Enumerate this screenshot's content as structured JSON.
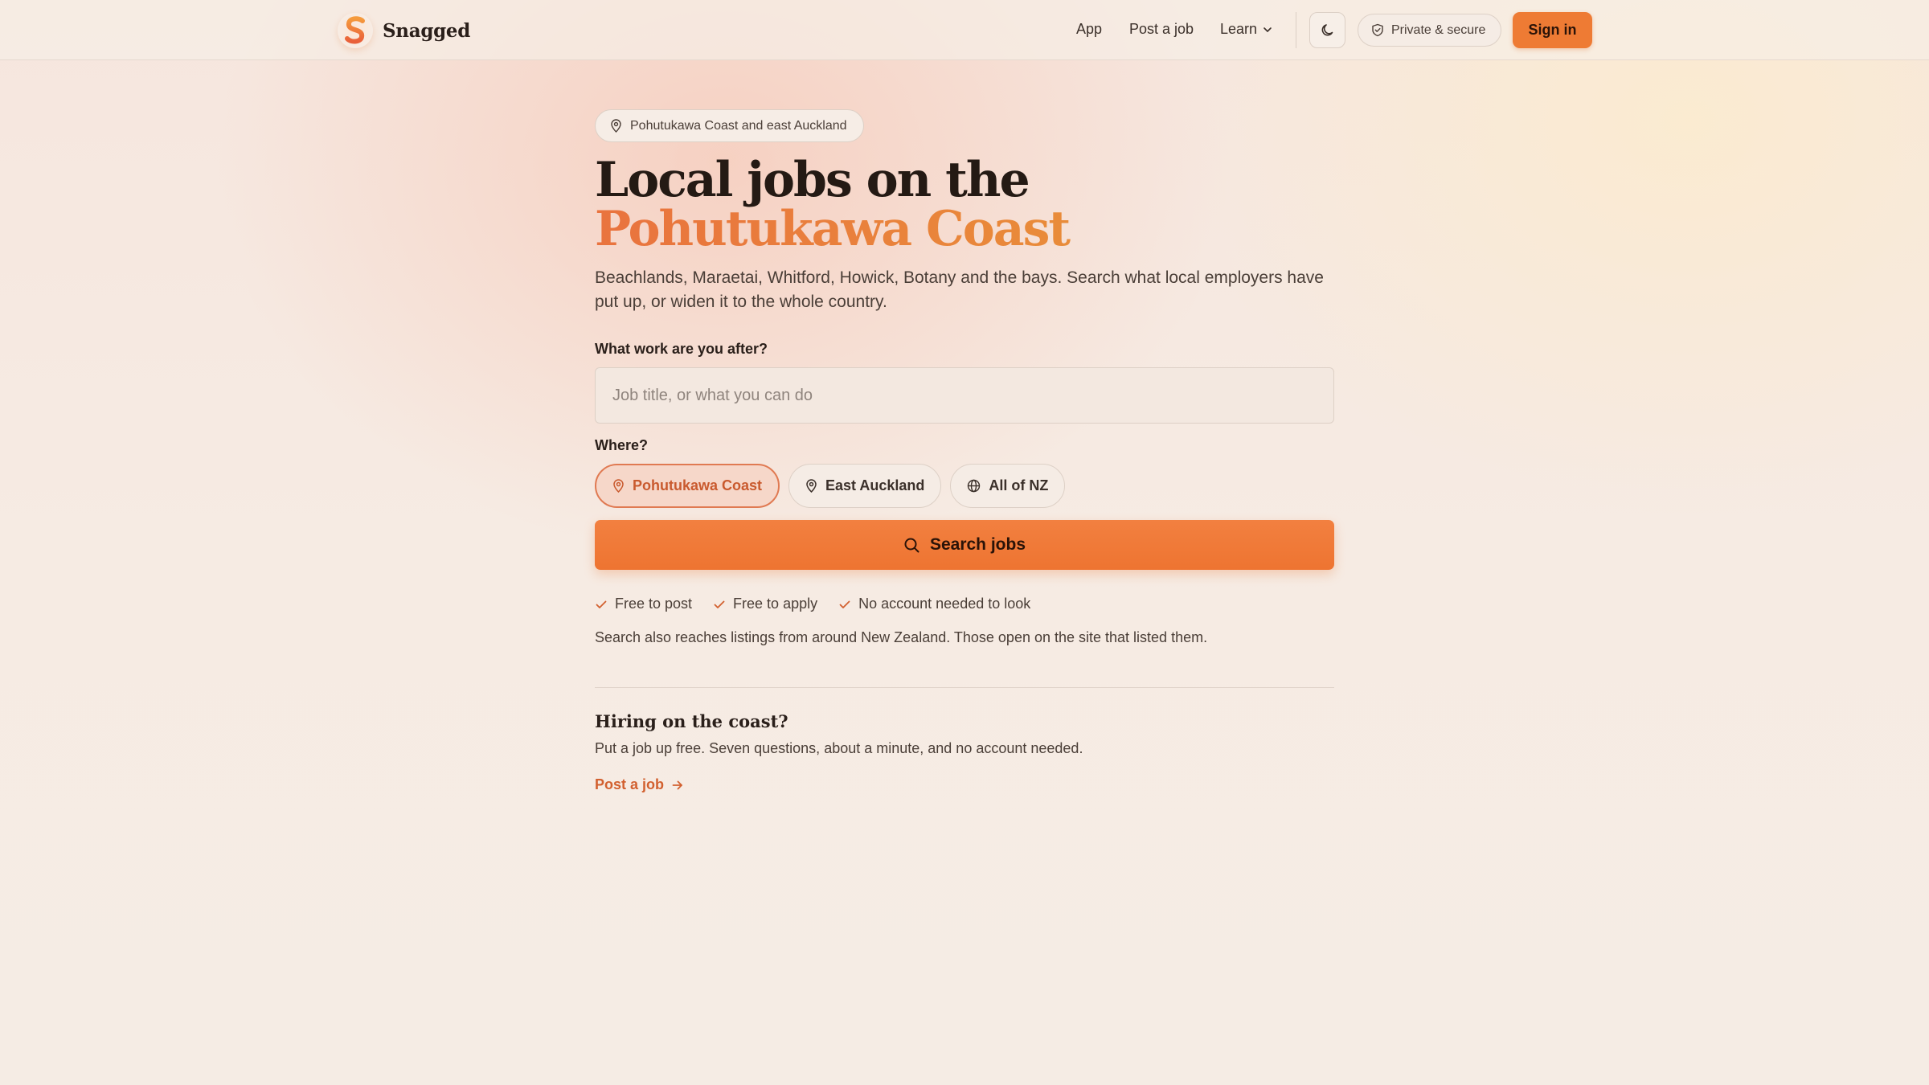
{
  "brand": {
    "name": "Snagged",
    "logo_letter": "S"
  },
  "nav": {
    "links": [
      "App",
      "Post a job",
      "Learn"
    ],
    "theme_toggle_icon": "moon-icon",
    "secure_label": "Private & secure",
    "signin_label": "Sign in"
  },
  "hero": {
    "location_pill": "Pohutukawa Coast and east Auckland",
    "title_line1": "Local jobs on the",
    "title_line2": "Pohutukawa Coast",
    "lead": "Beachlands, Maraetai, Whitford, Howick, Botany and the bays. Search what local employers have put up, or widen it to the whole country."
  },
  "search": {
    "work_label": "What work are you after?",
    "placeholder": "Job title, or what you can do",
    "value": "",
    "where_label": "Where?",
    "locations": [
      {
        "label": "Pohutukawa Coast",
        "icon": "map-pin-icon",
        "selected": true
      },
      {
        "label": "East Auckland",
        "icon": "map-pin-icon",
        "selected": false
      },
      {
        "label": "All of NZ",
        "icon": "globe-icon",
        "selected": false
      }
    ],
    "button_label": "Search jobs"
  },
  "perks": [
    "Free to post",
    "Free to apply",
    "No account needed to look"
  ],
  "note": "Search also reaches listings from around New Zealand. Those open on the site that listed them.",
  "hiring": {
    "title": "Hiring on the coast?",
    "text": "Put a job up free. Seven questions, about a minute, and no account needed.",
    "link_label": "Post a job"
  },
  "colors": {
    "accent": "#ee7b34",
    "accent_text": "#d2602f",
    "background": "#f6ebe3"
  }
}
